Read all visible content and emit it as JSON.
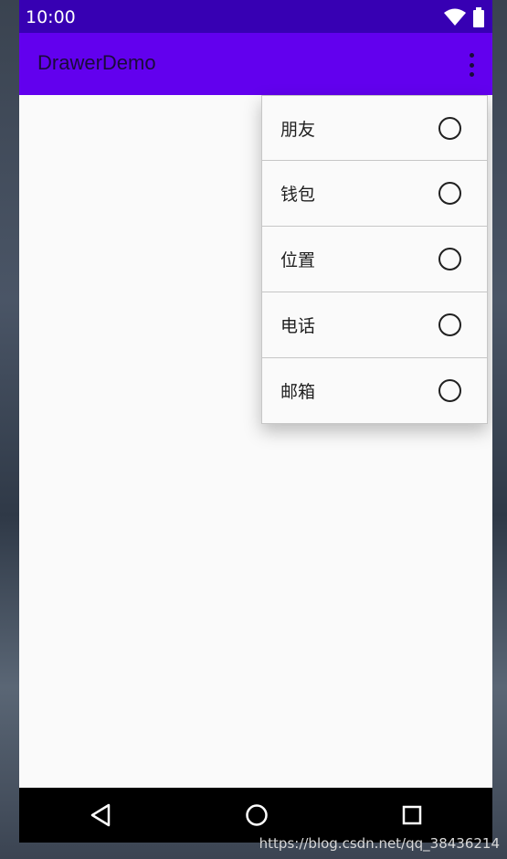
{
  "status_bar": {
    "time": "10:00",
    "icons": [
      "wifi-icon",
      "battery-icon"
    ]
  },
  "app_bar": {
    "title": "DrawerDemo",
    "overflow_icon": "more-vert-icon"
  },
  "menu": {
    "items": [
      {
        "label": "朋友",
        "checked": false
      },
      {
        "label": "钱包",
        "checked": false
      },
      {
        "label": "位置",
        "checked": false
      },
      {
        "label": "电话",
        "checked": false
      },
      {
        "label": "邮箱",
        "checked": false
      }
    ]
  },
  "nav_bar": {
    "buttons": [
      "back-icon",
      "home-icon",
      "recents-icon"
    ]
  },
  "watermark": "https://blog.csdn.net/qq_38436214",
  "colors": {
    "status_bar": "#3700b3",
    "app_bar": "#6200ee",
    "background": "#fafafa",
    "nav_bar": "#000000"
  }
}
